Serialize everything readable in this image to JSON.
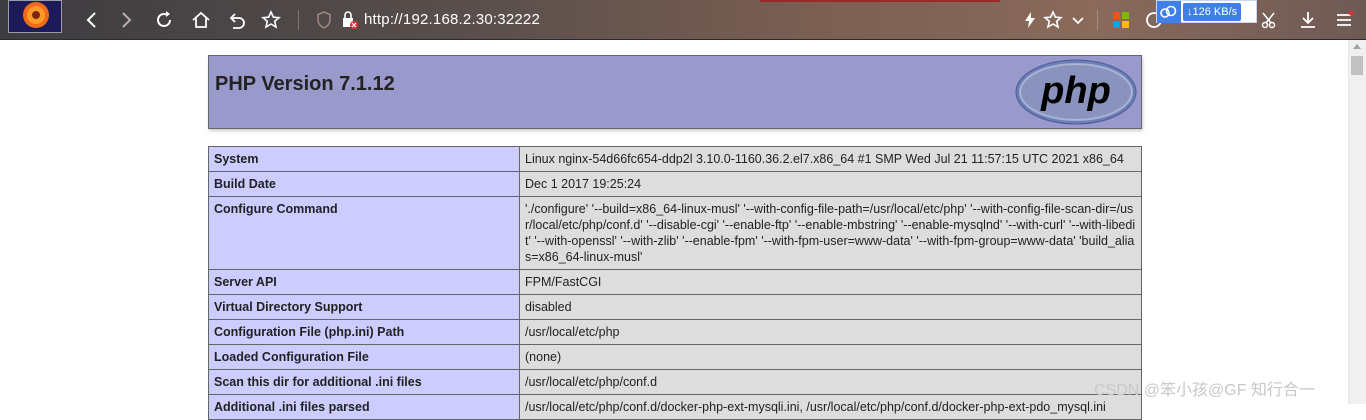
{
  "browser": {
    "url": "http://192.168.2.30:32222",
    "net_speed": "126 KB/s",
    "icons": [
      "back-icon",
      "forward-icon",
      "reload-icon",
      "home-icon",
      "undo-icon",
      "bookmark-star-icon",
      "shield-icon",
      "insecure-lock-icon",
      "lightning-icon",
      "star-icon",
      "chevron-down-icon",
      "apps-grid-icon",
      "cloud-icon",
      "scissors-icon",
      "download-icon",
      "menu-icon"
    ]
  },
  "php": {
    "title": "PHP Version 7.1.12",
    "logo_text": "php",
    "rows": [
      {
        "label": "System",
        "value": "Linux nginx-54d66fc654-ddp2l 3.10.0-1160.36.2.el7.x86_64 #1 SMP Wed Jul 21 11:57:15 UTC 2021 x86_64"
      },
      {
        "label": "Build Date",
        "value": "Dec 1 2017 19:25:24"
      },
      {
        "label": "Configure Command",
        "value": "'./configure' '--build=x86_64-linux-musl' '--with-config-file-path=/usr/local/etc/php' '--with-config-file-scan-dir=/usr/local/etc/php/conf.d' '--disable-cgi' '--enable-ftp' '--enable-mbstring' '--enable-mysqlnd' '--with-curl' '--with-libedit' '--with-openssl' '--with-zlib' '--enable-fpm' '--with-fpm-user=www-data' '--with-fpm-group=www-data' 'build_alias=x86_64-linux-musl'"
      },
      {
        "label": "Server API",
        "value": "FPM/FastCGI"
      },
      {
        "label": "Virtual Directory Support",
        "value": "disabled"
      },
      {
        "label": "Configuration File (php.ini) Path",
        "value": "/usr/local/etc/php"
      },
      {
        "label": "Loaded Configuration File",
        "value": "(none)"
      },
      {
        "label": "Scan this dir for additional .ini files",
        "value": "/usr/local/etc/php/conf.d"
      },
      {
        "label": "Additional .ini files parsed",
        "value": "/usr/local/etc/php/conf.d/docker-php-ext-mysqli.ini, /usr/local/etc/php/conf.d/docker-php-ext-pdo_mysql.ini"
      }
    ]
  },
  "watermark": "CSDN @笨小孩@GF 知行合一",
  "colors": {
    "header_bg": "#9999cc",
    "label_bg": "#ccccff",
    "value_bg": "#dddddd"
  }
}
